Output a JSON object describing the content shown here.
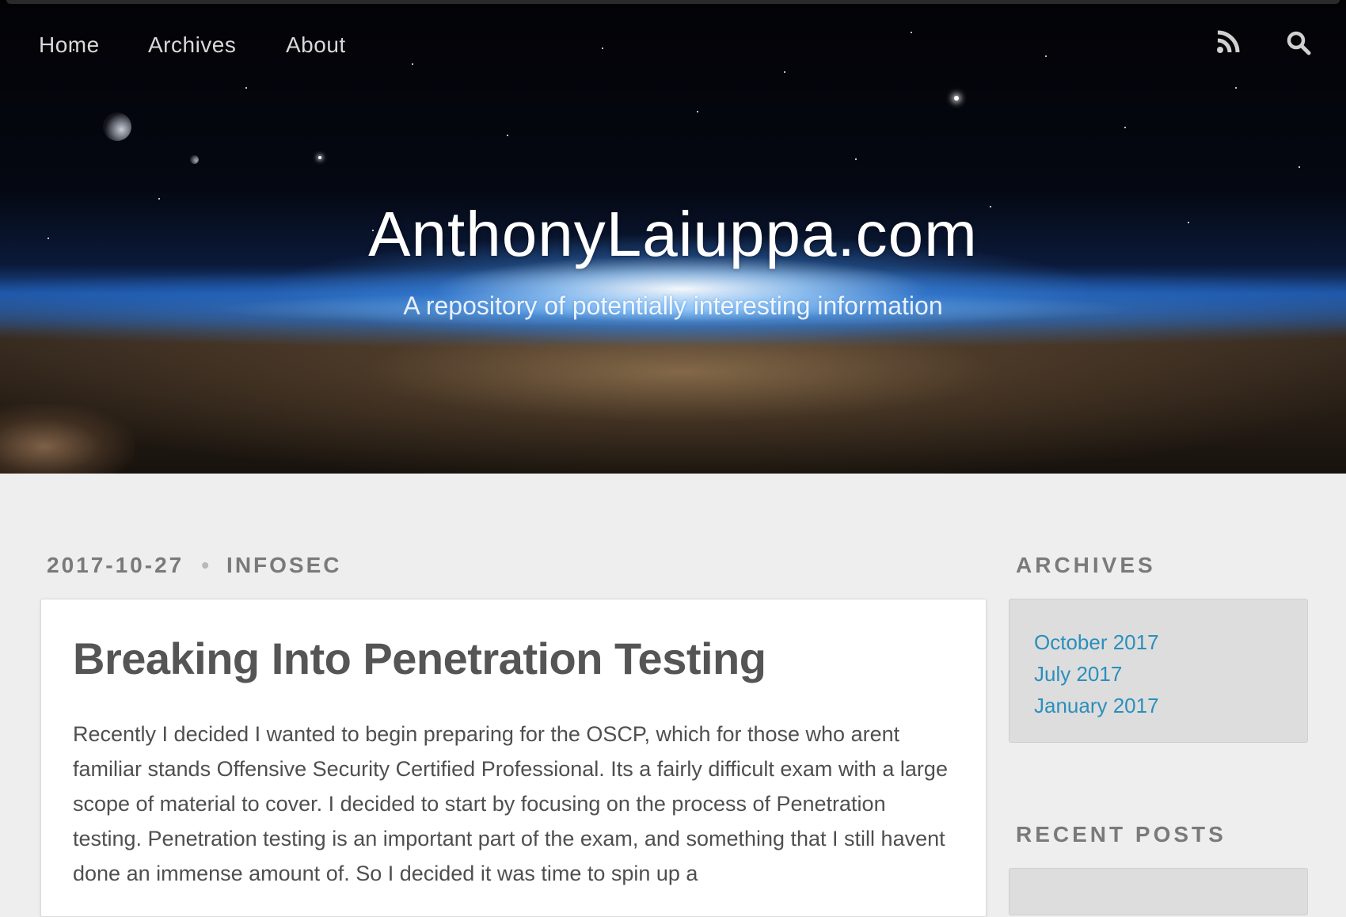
{
  "nav": {
    "items": [
      {
        "label": "Home"
      },
      {
        "label": "Archives"
      },
      {
        "label": "About"
      }
    ],
    "rss_icon": "rss-icon",
    "search_icon": "search-icon"
  },
  "header": {
    "title": "AnthonyLaiuppa.com",
    "subtitle": "A repository of potentially interesting information"
  },
  "post": {
    "date": "2017-10-27",
    "category": "INFOSEC",
    "title": "Breaking Into Penetration Testing",
    "excerpt": "Recently I decided I wanted to begin preparing for the OSCP, which for those who arent familiar stands Offensive Security Certified Professional. Its a fairly difficult exam with a large scope of material to cover. I decided to start by focusing on the process of Penetration testing. Penetration testing is an important part of the exam, and something that I still havent done an immense amount of. So I decided it was time to spin up a"
  },
  "sidebar": {
    "archives_heading": "ARCHIVES",
    "archives": [
      {
        "label": "October 2017"
      },
      {
        "label": "July 2017"
      },
      {
        "label": "January 2017"
      }
    ],
    "recent_heading": "RECENT POSTS"
  },
  "colors": {
    "link": "#2a8fbd",
    "page_background": "#eeeeee",
    "heading_gray": "#7a7a7a"
  }
}
